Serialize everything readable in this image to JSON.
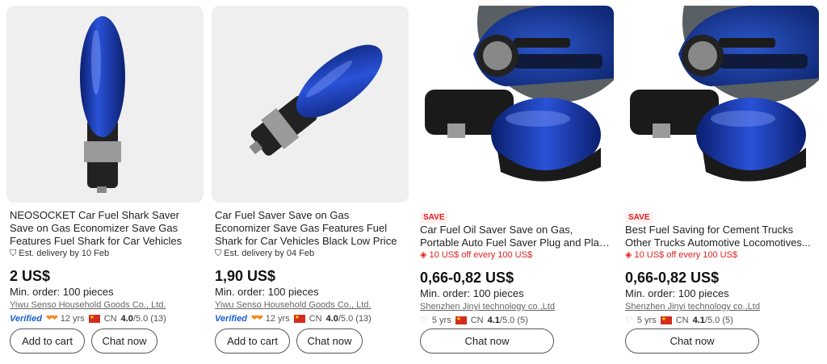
{
  "products": [
    {
      "title": "NEOSOCKET Car Fuel Shark Saver Save on Gas Economizer Save Gas Features Fuel Shark for Car Vehicles",
      "delivery": "Est. delivery by 10 Feb",
      "price": "2 US$",
      "moq": "Min. order: 100 pieces",
      "supplier": "Yiwu Senso Household Goods Co., Ltd.",
      "verified": "Verified",
      "years": "12 yrs",
      "country": "CN",
      "rating": "4.0",
      "rating_suffix": "/5.0 (13)",
      "cart_label": "Add to cart",
      "chat_label": "Chat now"
    },
    {
      "title": "Car Fuel Saver Save on Gas Economizer Save Gas Features Fuel Shark for Car Vehicles Black Low Price",
      "delivery": "Est. delivery by 04 Feb",
      "price": "1,90 US$",
      "moq": "Min. order: 100 pieces",
      "supplier": "Yiwu Senso Household Goods Co., Ltd.",
      "verified": "Verified",
      "years": "12 yrs",
      "country": "CN",
      "rating": "4.0",
      "rating_suffix": "/5.0 (13)",
      "cart_label": "Add to cart",
      "chat_label": "Chat now"
    },
    {
      "badge": "SAVE",
      "title": "Car Fuel Oil Saver Save on Gas, Portable Auto Fuel Saver Plug and Play for Car...",
      "promo": "10 US$ off every 100 US$",
      "price": "0,66-0,82 US$",
      "moq": "Min. order: 100 pieces",
      "supplier": "Shenzhen Jinyi technology co.,Ltd",
      "years": "5 yrs",
      "country": "CN",
      "rating": "4.1",
      "rating_suffix": "/5.0 (5)",
      "chat_label": "Chat now"
    },
    {
      "badge": "SAVE",
      "title": "Best Fuel Saving for Cement Trucks Other Trucks Automotive Locomotives...",
      "promo": "10 US$ off every 100 US$",
      "price": "0,66-0,82 US$",
      "moq": "Min. order: 100 pieces",
      "supplier": "Shenzhen Jinyi technology co.,Ltd",
      "years": "5 yrs",
      "country": "CN",
      "rating": "4.1",
      "rating_suffix": "/5.0 (5)",
      "chat_label": "Chat now"
    }
  ],
  "colors": {
    "device_blue": "#1c3fa8",
    "price": "#111111",
    "promo_red": "#e02020",
    "verified_blue": "#1a5fd1"
  }
}
